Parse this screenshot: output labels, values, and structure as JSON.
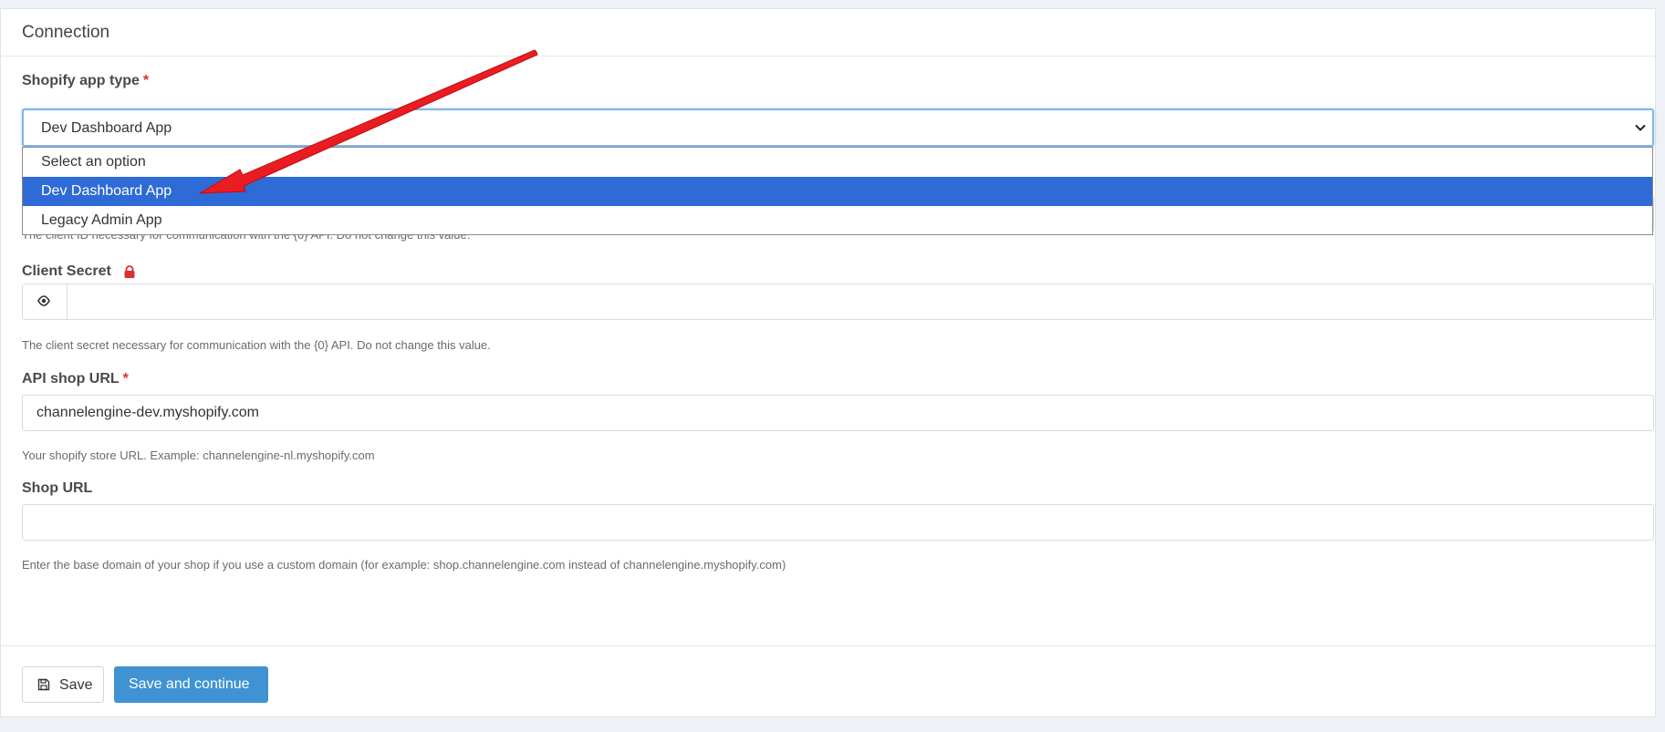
{
  "panel": {
    "title": "Connection"
  },
  "app_type": {
    "label": "Shopify app type",
    "required_mark": "*",
    "selected_value": "Dev Dashboard App",
    "options": [
      "Select an option",
      "Dev Dashboard App",
      "Legacy Admin App"
    ],
    "selected_index": 1
  },
  "client_id": {
    "help": "The client ID necessary for communication with the {0} API. Do not change this value."
  },
  "client_secret": {
    "label": "Client Secret",
    "value": "",
    "help": "The client secret necessary for communication with the {0} API. Do not change this value."
  },
  "api_shop_url": {
    "label": "API shop URL",
    "required_mark": "*",
    "value": "channelengine-dev.myshopify.com",
    "help": "Your shopify store URL. Example: channelengine-nl.myshopify.com"
  },
  "shop_url": {
    "label": "Shop URL",
    "value": "",
    "help": "Enter the base domain of your shop if you use a custom domain (for example: shop.channelengine.com instead of channelengine.myshopify.com)"
  },
  "buttons": {
    "save_label": "Save",
    "save_continue_label": "Save and continue"
  },
  "colors": {
    "accent": "#3f93d3",
    "selected_option": "#2e6bd6",
    "required": "#d9302f",
    "annotation_arrow": "#e8141c"
  },
  "icons": {
    "lock": "lock-icon",
    "eye": "eye-icon",
    "save": "floppy-disk-icon",
    "chevron": "chevron-down-icon"
  }
}
